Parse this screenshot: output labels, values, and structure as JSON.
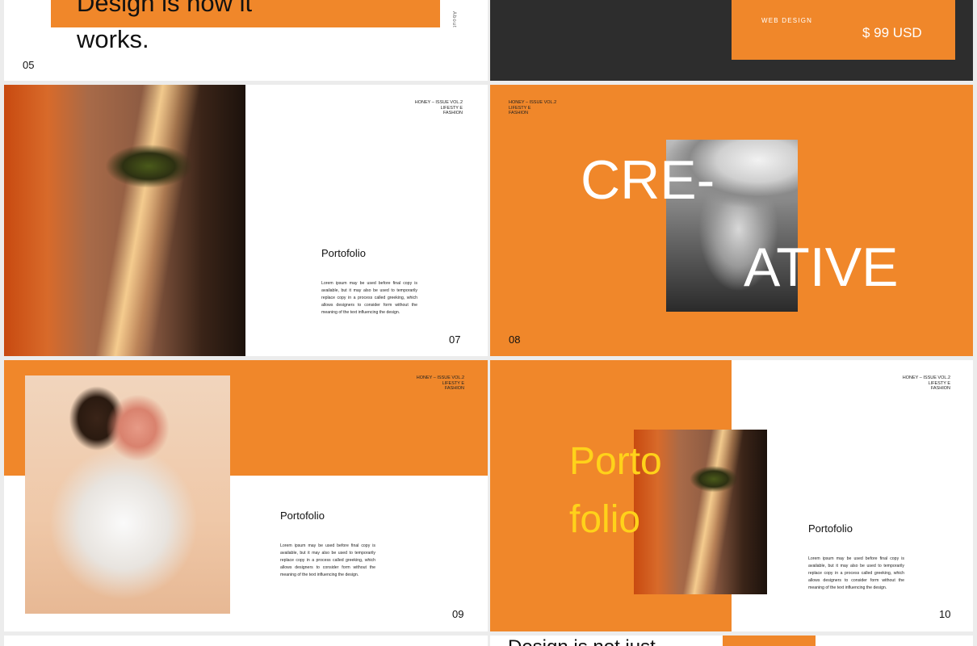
{
  "slide05": {
    "headline_line1": "Design is now it",
    "headline_line2": "works.",
    "side_label": "About",
    "page_number": "05"
  },
  "slide06": {
    "tag": "WEB DESIGN",
    "price": "$ 99 USD"
  },
  "slide07": {
    "header_lines": [
      "HONEY – ISSUE VOL.2",
      "LIFESTY E",
      "FASHION"
    ],
    "title": "Portofolio",
    "body": "Lorem ipsum may be used before final copy is available, but it may also be used to temporarily replace copy in a process called greeking, which allows designers to consider form without the meaning of the text influencing the design.",
    "page_number": "07"
  },
  "slide08": {
    "header_lines": [
      "HONEY – ISSUE VOL.2",
      "LIFESTY E",
      "FASHION"
    ],
    "word1": "CRE-",
    "word2": "ATIVE",
    "page_number": "08"
  },
  "slide09": {
    "header_lines": [
      "HONEY – ISSUE VOL.2",
      "LIFESTY E",
      "FASHION"
    ],
    "title": "Portofolio",
    "body": "Lorem ipsum may be used before final copy is available, but it may also be used to temporarily replace copy in a process called greeking, which allows designers to consider form without the meaning of the text influencing the design.",
    "page_number": "09"
  },
  "slide10": {
    "header_lines": [
      "HONEY – ISSUE VOL.2",
      "LIFESTY E",
      "FASHION"
    ],
    "big_line1": "Porto",
    "big_line2": "folio",
    "title": "Portofolio",
    "body": "Lorem ipsum may be used before final copy is available, but it may also be used to temporarily replace copy in a process called greeking, which allows designers to consider form without the meaning of the text influencing the design.",
    "page_number": "10"
  },
  "slide12": {
    "headline_partial": "Design is not just"
  },
  "colors": {
    "orange": "#f0872a",
    "dark": "#2d2d2d",
    "yellow": "#ffd21a",
    "white": "#ffffff"
  }
}
